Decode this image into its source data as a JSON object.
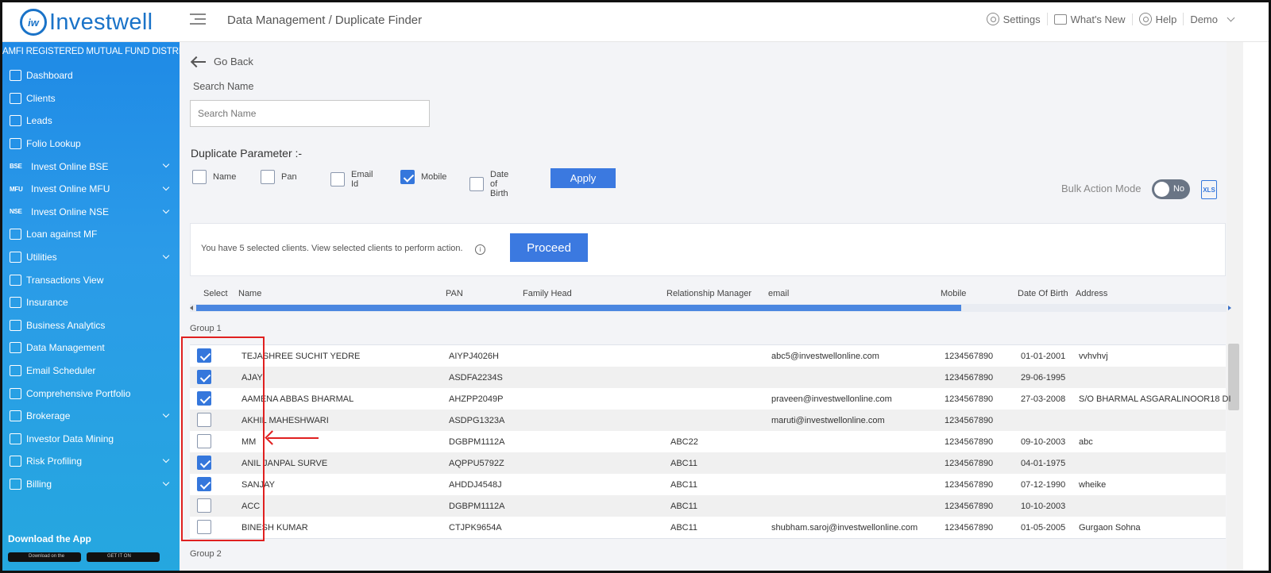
{
  "header": {
    "logo_mark": "iw",
    "logo_text": "Investwell",
    "breadcrumb": "Data Management / Duplicate Finder",
    "settings": "Settings",
    "whats_new": "What's New",
    "help": "Help",
    "user": "Demo"
  },
  "sidebar": {
    "tagline": "AMFI REGISTERED MUTUAL FUND DISTRIBUTOR",
    "items": [
      {
        "label": "Dashboard",
        "icon": "home-icon",
        "expandable": false
      },
      {
        "label": "Clients",
        "icon": "users-icon",
        "expandable": false
      },
      {
        "label": "Leads",
        "icon": "leads-icon",
        "expandable": false
      },
      {
        "label": "Folio Lookup",
        "icon": "rupee-icon",
        "expandable": false
      },
      {
        "label": "Invest Online BSE",
        "tag": "BSE",
        "expandable": true
      },
      {
        "label": "Invest Online MFU",
        "tag": "MFU",
        "expandable": true
      },
      {
        "label": "Invest Online NSE",
        "tag": "NSE",
        "expandable": true
      },
      {
        "label": "Loan against MF",
        "icon": "loan-icon",
        "expandable": false
      },
      {
        "label": "Utilities",
        "icon": "utilities-icon",
        "expandable": true
      },
      {
        "label": "Transactions View",
        "icon": "transfer-icon",
        "expandable": false
      },
      {
        "label": "Insurance",
        "icon": "insurance-icon",
        "expandable": false
      },
      {
        "label": "Business Analytics",
        "icon": "chart-icon",
        "expandable": false
      },
      {
        "label": "Data Management",
        "icon": "data-icon",
        "expandable": false
      },
      {
        "label": "Email Scheduler",
        "icon": "email-icon",
        "expandable": false
      },
      {
        "label": "Comprehensive Portfolio",
        "icon": "portfolio-icon",
        "expandable": false
      },
      {
        "label": "Brokerage",
        "icon": "brokerage-icon",
        "expandable": true
      },
      {
        "label": "Investor Data Mining",
        "icon": "mining-icon",
        "expandable": false
      },
      {
        "label": "Risk Profiling",
        "icon": "risk-icon",
        "expandable": true
      },
      {
        "label": "Billing",
        "icon": "billing-icon",
        "expandable": true
      }
    ],
    "download_app": "Download the App",
    "app_store": "Download on the",
    "play_store": "GET IT ON"
  },
  "page": {
    "go_back": "Go Back",
    "search_label": "Search Name",
    "search_placeholder": "Search Name",
    "search_value": "",
    "duplicate_parameter_label": "Duplicate Parameter :-",
    "params": [
      {
        "label": "Name",
        "checked": false
      },
      {
        "label": "Pan",
        "checked": false
      },
      {
        "label": "Email Id",
        "checked": false
      },
      {
        "label": "Mobile",
        "checked": true
      },
      {
        "label": "Date of Birth",
        "checked": false
      }
    ],
    "apply": "Apply",
    "bulk_action_label": "Bulk Action Mode",
    "bulk_action_value": "No",
    "xls_label": "XLS",
    "notice": "You have 5 selected clients. View selected clients to perform action.",
    "info": "i",
    "proceed": "Proceed"
  },
  "table": {
    "columns": [
      "Select",
      "Name",
      "PAN",
      "Family Head",
      "Relationship Manager",
      "email",
      "Mobile",
      "Date Of Birth",
      "Address"
    ],
    "group1_label": "Group 1",
    "group2_label": "Group 2",
    "rows": [
      {
        "checked": true,
        "name": "TEJASHREE SUCHIT YEDRE",
        "pan": "AIYPJ4026H",
        "rm": "",
        "email": "abc5@investwellonline.com",
        "mobile": "1234567890",
        "dob": "01-01-2001",
        "address": "vvhvhvj"
      },
      {
        "checked": true,
        "name": "AJAY",
        "pan": "ASDFA2234S",
        "rm": "",
        "email": "",
        "mobile": "1234567890",
        "dob": "29-06-1995",
        "address": ""
      },
      {
        "checked": true,
        "name": "AAMENA ABBAS BHARMAL",
        "pan": "AHZPP2049P",
        "rm": "",
        "email": "praveen@investwellonline.com",
        "mobile": "1234567890",
        "dob": "27-03-2008",
        "address": "S/O BHARMAL ASGARALINOOR18 DI"
      },
      {
        "checked": false,
        "name": "AKHIL MAHESHWARI",
        "pan": "ASDPG1323A",
        "rm": "",
        "email": "maruti@investwellonline.com",
        "mobile": "1234567890",
        "dob": "",
        "address": ""
      },
      {
        "checked": false,
        "name": "MM",
        "pan": "DGBPM1112A",
        "rm": "ABC22",
        "email": "",
        "mobile": "1234567890",
        "dob": "09-10-2003",
        "address": "abc"
      },
      {
        "checked": true,
        "name": "ANIL JANPAL SURVE",
        "pan": "AQPPU5792Z",
        "rm": "ABC11",
        "email": "",
        "mobile": "1234567890",
        "dob": "04-01-1975",
        "address": ""
      },
      {
        "checked": true,
        "name": "SANJAY",
        "pan": "AHDDJ4548J",
        "rm": "ABC11",
        "email": "",
        "mobile": "1234567890",
        "dob": "07-12-1990",
        "address": "wheike"
      },
      {
        "checked": false,
        "name": "ACC",
        "pan": "DGBPM1112A",
        "rm": "ABC11",
        "email": "",
        "mobile": "1234567890",
        "dob": "10-10-2003",
        "address": ""
      },
      {
        "checked": false,
        "name": "BINESH KUMAR",
        "pan": "CTJPK9654A",
        "rm": "ABC11",
        "email": "shubham.saroj@investwellonline.com",
        "mobile": "1234567890",
        "dob": "01-05-2005",
        "address": "Gurgaon Sohna"
      }
    ]
  },
  "colors": {
    "brand_blue": "#1a73c8",
    "button_blue": "#3b79e0",
    "annotation_red": "#e02020"
  }
}
